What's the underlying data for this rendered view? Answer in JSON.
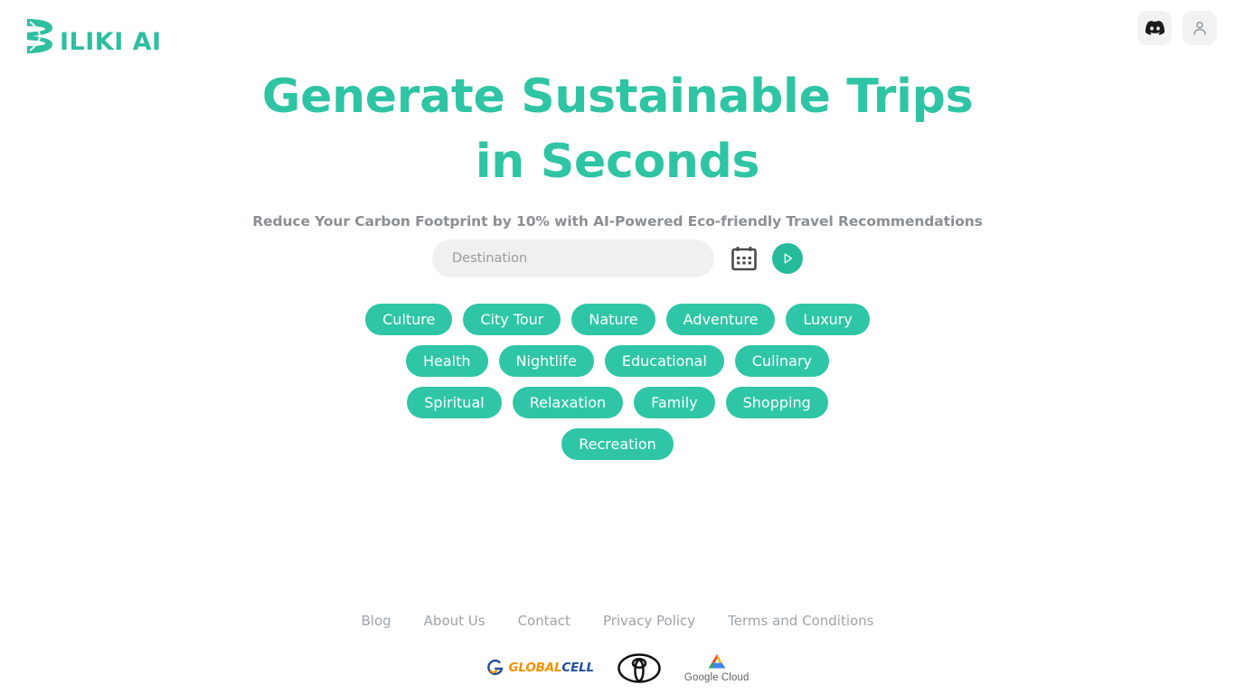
{
  "brand": {
    "logo_text": "ILIKI AI",
    "logo_mark": "b-ribbon-logo-icon",
    "accent_color": "#2EC4A4",
    "accent_color_dark": "#25BB9B"
  },
  "header": {
    "actions": [
      {
        "name": "discord-button",
        "icon": "discord-icon",
        "label": "Discord"
      },
      {
        "name": "account-button",
        "icon": "user-icon",
        "label": "Account"
      }
    ]
  },
  "hero": {
    "title_line_1": "Generate Sustainable Trips",
    "title_line_2": "in Seconds",
    "subtitle": "Reduce Your Carbon Footprint by 10% with AI-Powered Eco-friendly Travel Recommendations"
  },
  "search": {
    "placeholder": "Destination",
    "value": "",
    "calendar_icon": "calendar-icon",
    "submit_icon": "play-icon"
  },
  "tags": {
    "rows": [
      [
        "Culture",
        "City Tour",
        "Nature",
        "Adventure",
        "Luxury"
      ],
      [
        "Health",
        "Nightlife",
        "Educational",
        "Culinary"
      ],
      [
        "Spiritual",
        "Relaxation",
        "Family",
        "Shopping"
      ],
      [
        "Recreation"
      ]
    ]
  },
  "footer": {
    "links": [
      "Blog",
      "About Us",
      "Contact",
      "Privacy Policy",
      "Terms and Conditions"
    ],
    "partners": [
      {
        "name": "globalcell-logo",
        "text_1": "GLOBAL",
        "text_2": "CELL"
      },
      {
        "name": "toyota-logo",
        "text": "Toyota"
      },
      {
        "name": "google-cloud-logo",
        "text": "Google Cloud"
      }
    ]
  }
}
